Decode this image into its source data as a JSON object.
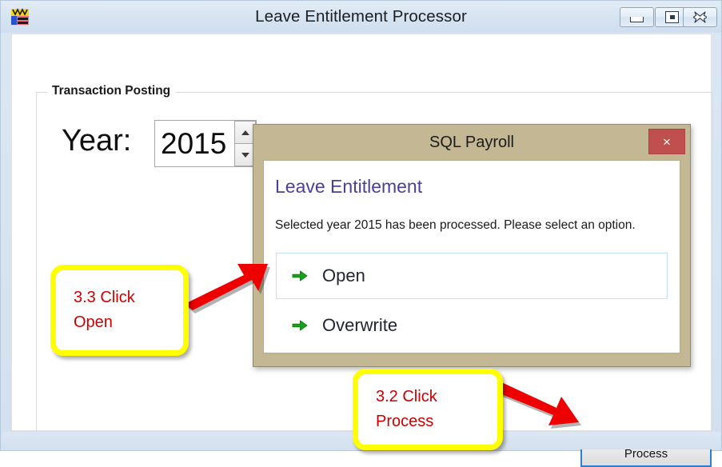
{
  "window": {
    "title": "Leave Entitlement Processor",
    "icon": "app-icon",
    "controls": {
      "minimize_label": "–",
      "maximize_label": "□",
      "close_label": "✕"
    }
  },
  "group_box": {
    "label": "Transaction Posting"
  },
  "year_field": {
    "label": "Year:",
    "value": "2015",
    "spin_up_icon": "triangle-up-icon",
    "spin_down_icon": "triangle-down-icon"
  },
  "process_button": {
    "label": "Process"
  },
  "dialog": {
    "title": "SQL Payroll",
    "close_label": "×",
    "heading": "Leave Entitlement",
    "message": "Selected year 2015 has been processed. Please select an option.",
    "heading_color": "#4b3f9e",
    "title_bar_color": "#c3b893",
    "close_button_color": "#c0504d",
    "options": [
      {
        "label": "Open",
        "icon": "green-arrow-icon",
        "highlighted": true
      },
      {
        "label": "Overwrite",
        "icon": "green-arrow-icon",
        "highlighted": false
      }
    ]
  },
  "annotations": {
    "accent_border": "#ffff00",
    "text_color": "#cc0000",
    "arrow_color": "#ee0000",
    "callouts": [
      {
        "line1": "3.3 Click",
        "line2": "Open"
      },
      {
        "line1": "3.2 Click",
        "line2": "Process"
      }
    ]
  }
}
